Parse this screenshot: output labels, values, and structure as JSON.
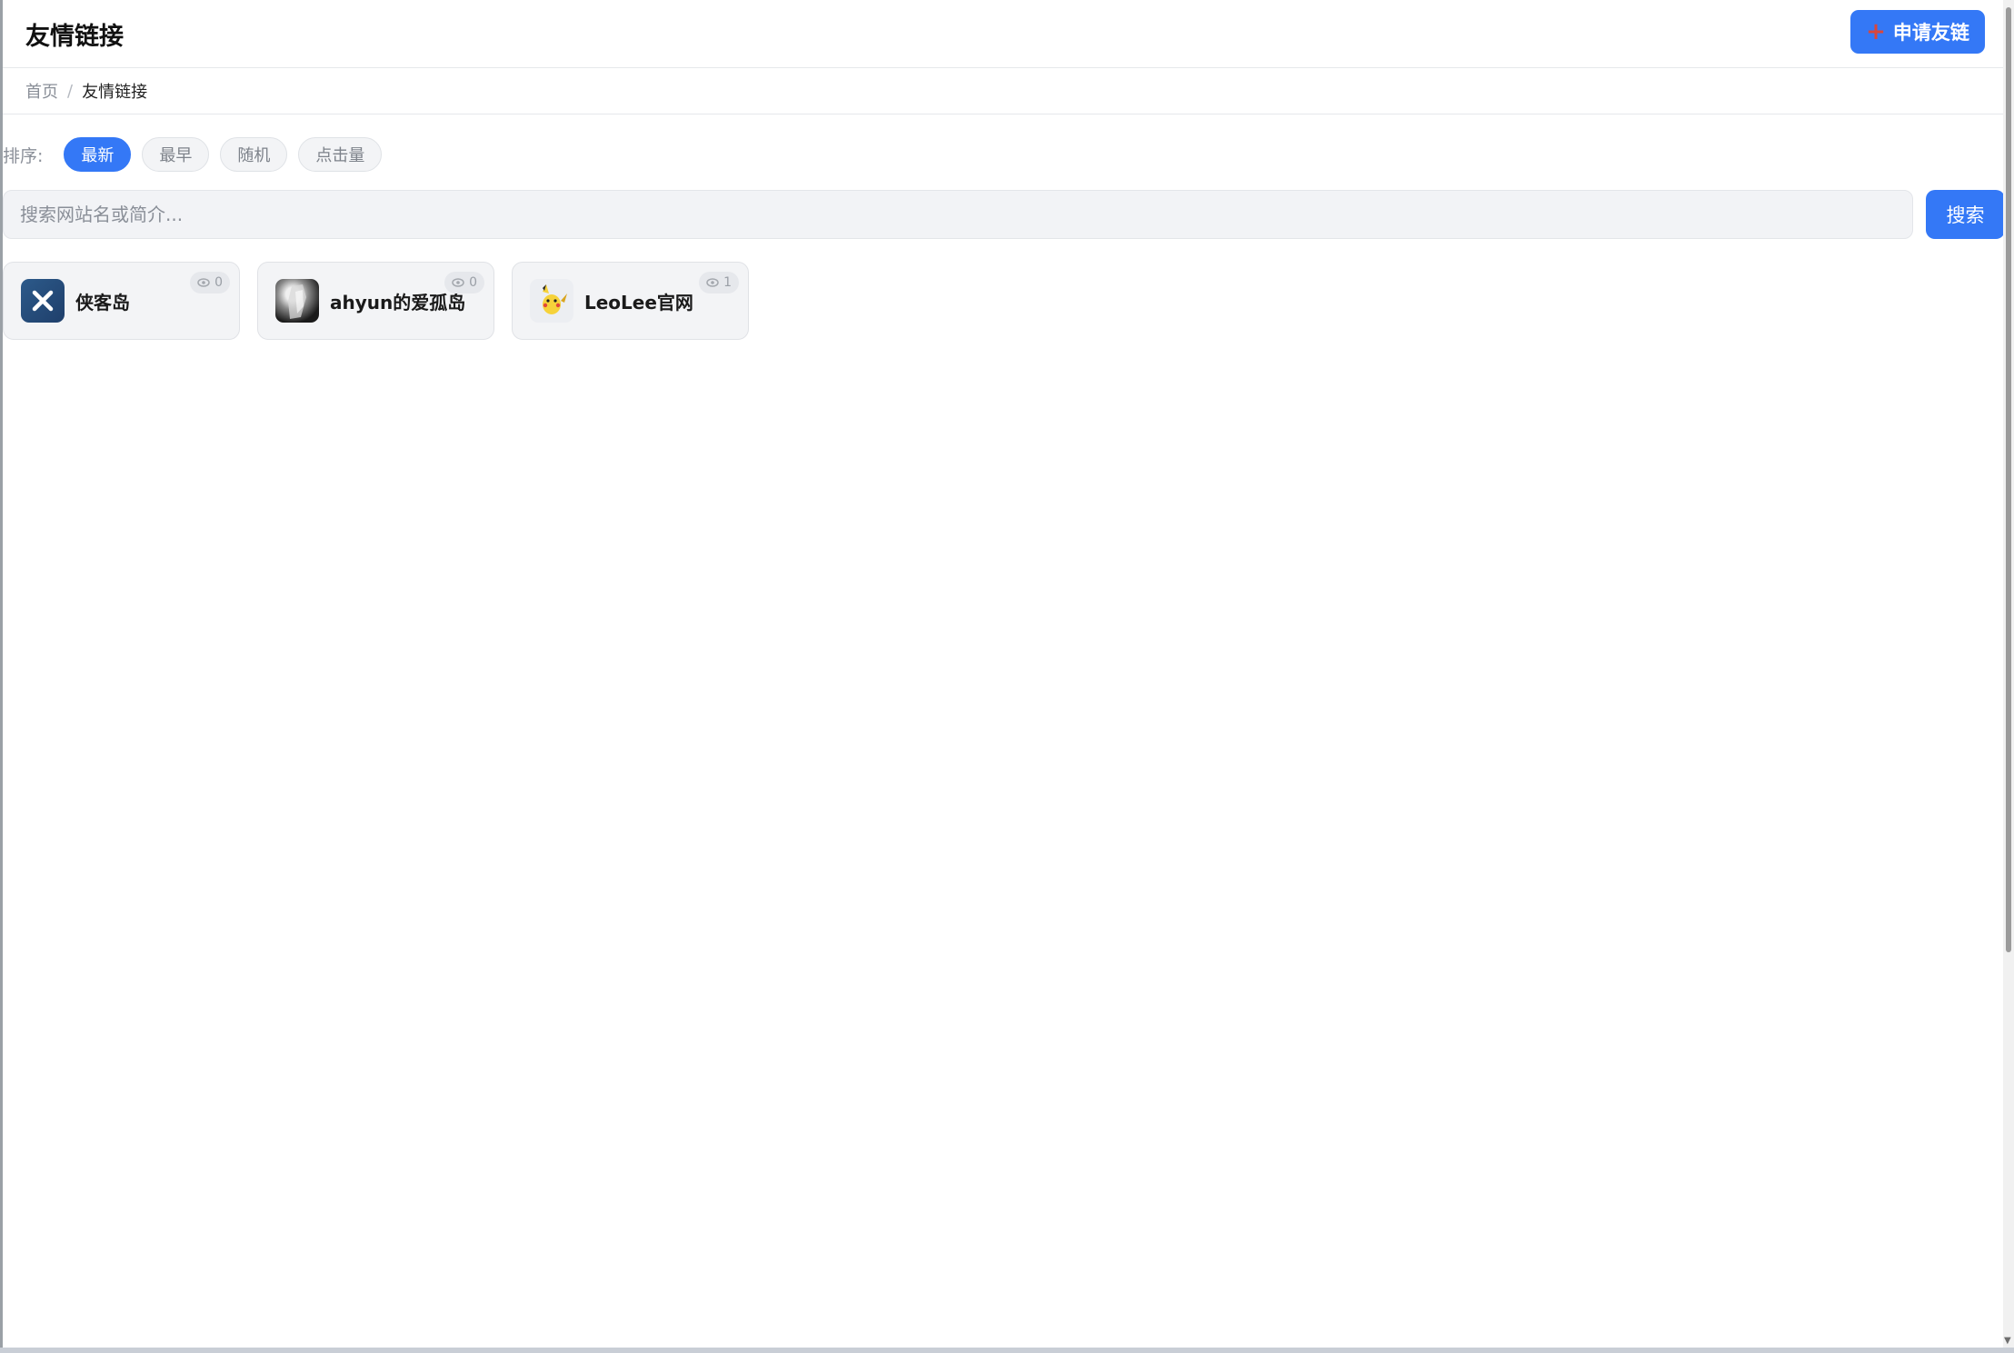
{
  "header": {
    "title": "友情链接",
    "apply_button": "申请友链"
  },
  "breadcrumb": {
    "home": "首页",
    "separator": "/",
    "current": "友情链接"
  },
  "sort": {
    "label": "排序:",
    "options": [
      "最新",
      "最早",
      "随机",
      "点击量"
    ],
    "selected": "最新"
  },
  "search": {
    "placeholder": "搜索网站名或简介...",
    "value": "",
    "button": "搜索"
  },
  "links": [
    {
      "name": "侠客岛",
      "views": "0",
      "icon": "x-logo-icon"
    },
    {
      "name": "ahyun的爱孤岛",
      "views": "0",
      "icon": "photo-avatar"
    },
    {
      "name": "LeoLee官网",
      "views": "1",
      "icon": "pikachu-avatar"
    }
  ],
  "colors": {
    "accent": "#3478f6",
    "card_bg": "#f3f4f6"
  }
}
